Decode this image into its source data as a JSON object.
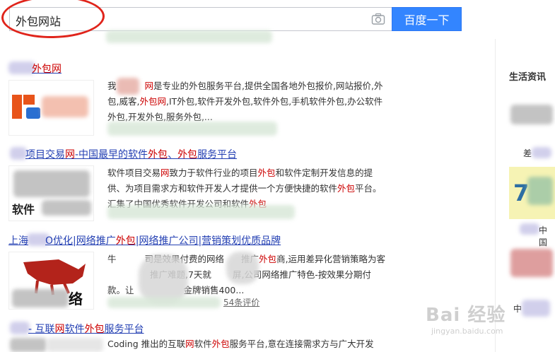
{
  "search": {
    "query": "外包网站",
    "button_label": "百度一下"
  },
  "results": [
    {
      "title": {
        "pre": "",
        "red1": "外包网",
        "mid": "",
        "red2": "",
        "post": ""
      },
      "abstract": [
        {
          "t": "我"
        },
        {
          "t": "网",
          "red": true
        },
        {
          "t": "是专业的外包服务平台,提供全国各地外包报价,网站报价,外包,威客,"
        },
        {
          "t": "外包网",
          "red": true
        },
        {
          "t": ",IT外包,软件开发外包,软件外包,手机软件外包,办公软件外包,开发外包,服务外包,..."
        }
      ]
    },
    {
      "title": {
        "pre": "项目交易",
        "red1": "网",
        "mid": "-中国最早的软件",
        "red2": "外包",
        "post": "、",
        "red3": "外包",
        "tail": "服务平台"
      },
      "abstract": [
        {
          "t": "软件项目交易"
        },
        {
          "t": "网",
          "red": true
        },
        {
          "t": "致力于软件行业的项目"
        },
        {
          "t": "外包",
          "red": true
        },
        {
          "t": "和软件定制开发信息的提供、为项目需求方和软件开发人才提供一个方便快捷的软件"
        },
        {
          "t": "外包",
          "red": true
        },
        {
          "t": "平台。汇集了中国优秀软件开发公司和软件"
        },
        {
          "t": "外包",
          "red": true
        }
      ]
    },
    {
      "title": {
        "pre": "上海",
        "red1": "",
        "mid": "O优化|网络推广",
        "red2": "外包",
        "post": "|网络推广公司|营销策划优质品牌"
      },
      "abstract": [
        {
          "t": "牛"
        },
        {
          "t": "司是效果付费的网络"
        },
        {
          "t": "推广"
        },
        {
          "t": "外包",
          "red": true
        },
        {
          "t": "商,运用差异化营销策略为客"
        },
        {
          "t": "推广难题,7天就"
        },
        {
          "t": "屏,公司网络推广特色-按效果分期付款。让"
        },
        {
          "t": "金牌销售400..."
        }
      ],
      "reviews": "54条评价"
    },
    {
      "title": {
        "pre": "- 互联",
        "red1": "网",
        "mid": "软件",
        "red2": "外包",
        "post": "服务平台"
      },
      "abstract": [
        {
          "t": "Coding 推出的互联"
        },
        {
          "t": "网",
          "red": true
        },
        {
          "t": "软件"
        },
        {
          "t": "外包",
          "red": true
        },
        {
          "t": "服务平台,意在连接需求方与广大开发者。让项目的需求"
        }
      ]
    }
  ],
  "sidebar": {
    "title": "生活资讯",
    "labels": [
      "差",
      "中国",
      "中"
    ]
  },
  "watermark": {
    "main": "Bai 经验",
    "sub": "jingyan.baidu.com"
  },
  "thumb_text": {
    "result2": "软件",
    "result3": "络"
  }
}
